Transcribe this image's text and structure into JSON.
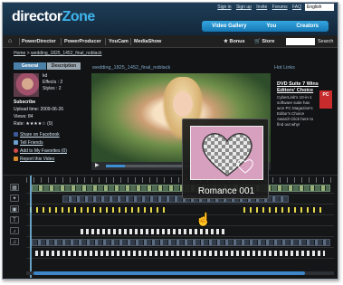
{
  "header": {
    "logo_part1": "director",
    "logo_part2": "Zone",
    "links": [
      "Sign in",
      "Sign up",
      "Invite",
      "Forums",
      "FAQ"
    ],
    "language": "English",
    "nav": [
      "Video Gallery",
      "You",
      "Creators"
    ]
  },
  "subnav": {
    "items": [
      "PowerDirector",
      "PowerProducer",
      "YouCam",
      "MediaShow"
    ],
    "bonus": "Bonus",
    "store": "Store",
    "search_label": "Search"
  },
  "breadcrumb": {
    "home": "Home",
    "page": "wedding_1825_1452_final_noblack"
  },
  "profile": {
    "tab_general": "General",
    "tab_description": "Description",
    "user_label": "kd",
    "effects": "Effects : 2",
    "styles": "Styles : 2",
    "subscribe": "Subscribe",
    "upload": "Upload time: 2009-06-26",
    "views": "Views: 84",
    "rate": "Rate: ★★★★☆ (0)",
    "share_facebook": "Share on Facebook",
    "tell_friends": "Tell Friends",
    "add_favorites": "Add to My Favorites (0)",
    "report": "Report this Video"
  },
  "video": {
    "title": "wedding_1825_1452_final_noblack",
    "progress_fraction": 0.12
  },
  "hotlinks": {
    "heading": "Hot Links",
    "ad_title": "DVD Suite 7 Wins Editors' Choice",
    "ad_body": "CyberLink's 10-in-1 software suite has won PC Magazine's Editor's Choice Award! Click here to find out why!",
    "badge": "PC"
  },
  "timeline": {
    "popup_label": "Romance 001",
    "track_icons": [
      "film-icon",
      "fx-icon",
      "overlay-icon",
      "title-icon",
      "audio-icon",
      "music-icon"
    ]
  }
}
